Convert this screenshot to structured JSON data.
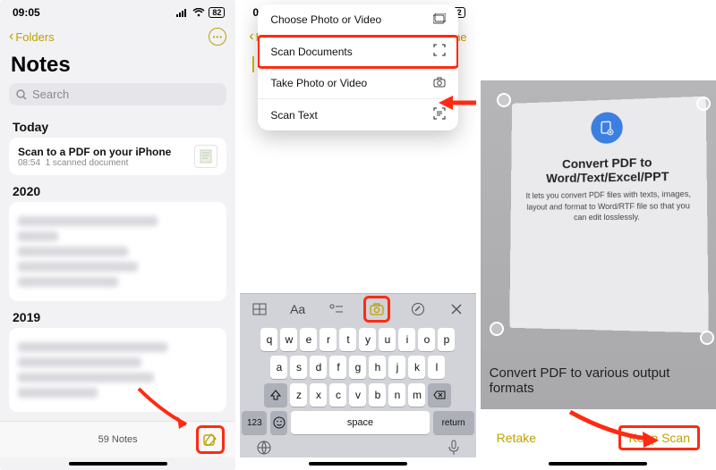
{
  "status": {
    "time": "09:05",
    "battery_text": "82"
  },
  "phone1": {
    "back_label": "Folders",
    "title": "Notes",
    "search_placeholder": "Search",
    "section_today": "Today",
    "today_note_title": "Scan to a PDF on your iPhone",
    "today_note_time": "08:54",
    "today_note_sub": "1 scanned document",
    "section_2020": "2020",
    "section_2019": "2019",
    "footer_count": "59 Notes"
  },
  "phone2": {
    "back_label": "Notes",
    "done_label": "Done",
    "menu": {
      "choose": "Choose Photo or Video",
      "scan_docs": "Scan Documents",
      "take": "Take Photo or Video",
      "scan_text": "Scan Text"
    },
    "kb_top_aa": "Aa",
    "keys_r1": [
      "q",
      "w",
      "e",
      "r",
      "t",
      "y",
      "u",
      "i",
      "o",
      "p"
    ],
    "keys_r2": [
      "a",
      "s",
      "d",
      "f",
      "g",
      "h",
      "j",
      "k",
      "l"
    ],
    "keys_r3": [
      "z",
      "x",
      "c",
      "v",
      "b",
      "n",
      "m"
    ],
    "key_123": "123",
    "key_space": "space",
    "key_return": "return"
  },
  "phone3": {
    "card_title": "Convert PDF to Word/Text/Excel/PPT",
    "card_body": "It lets you convert PDF files with texts, images, layout and format to Word/RTF file so that you can edit losslessly.",
    "subline": "Convert PDF to various output formats",
    "retake": "Retake",
    "keep": "Keep Scan"
  }
}
